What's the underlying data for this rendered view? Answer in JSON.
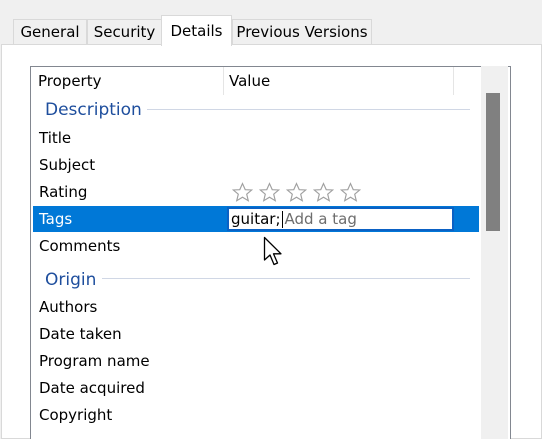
{
  "tabs": [
    {
      "label": "General"
    },
    {
      "label": "Security"
    },
    {
      "label": "Details"
    },
    {
      "label": "Previous Versions"
    }
  ],
  "table": {
    "headers": {
      "property": "Property",
      "value": "Value"
    }
  },
  "groups": {
    "description": "Description",
    "origin": "Origin"
  },
  "properties": {
    "title": "Title",
    "subject": "Subject",
    "rating": "Rating",
    "tags": "Tags",
    "comments": "Comments",
    "authors": "Authors",
    "date_taken": "Date taken",
    "program_name": "Program name",
    "date_acquired": "Date acquired",
    "copyright": "Copyright"
  },
  "rating": {
    "stars_total": 5,
    "stars_filled": 0
  },
  "tags_editor": {
    "value": "guitar",
    "separator": ";",
    "placeholder": "Add a tag"
  },
  "colors": {
    "selection": "#0078d7",
    "group_heading": "#1e4e9d",
    "edit_border": "#0b61c4"
  }
}
